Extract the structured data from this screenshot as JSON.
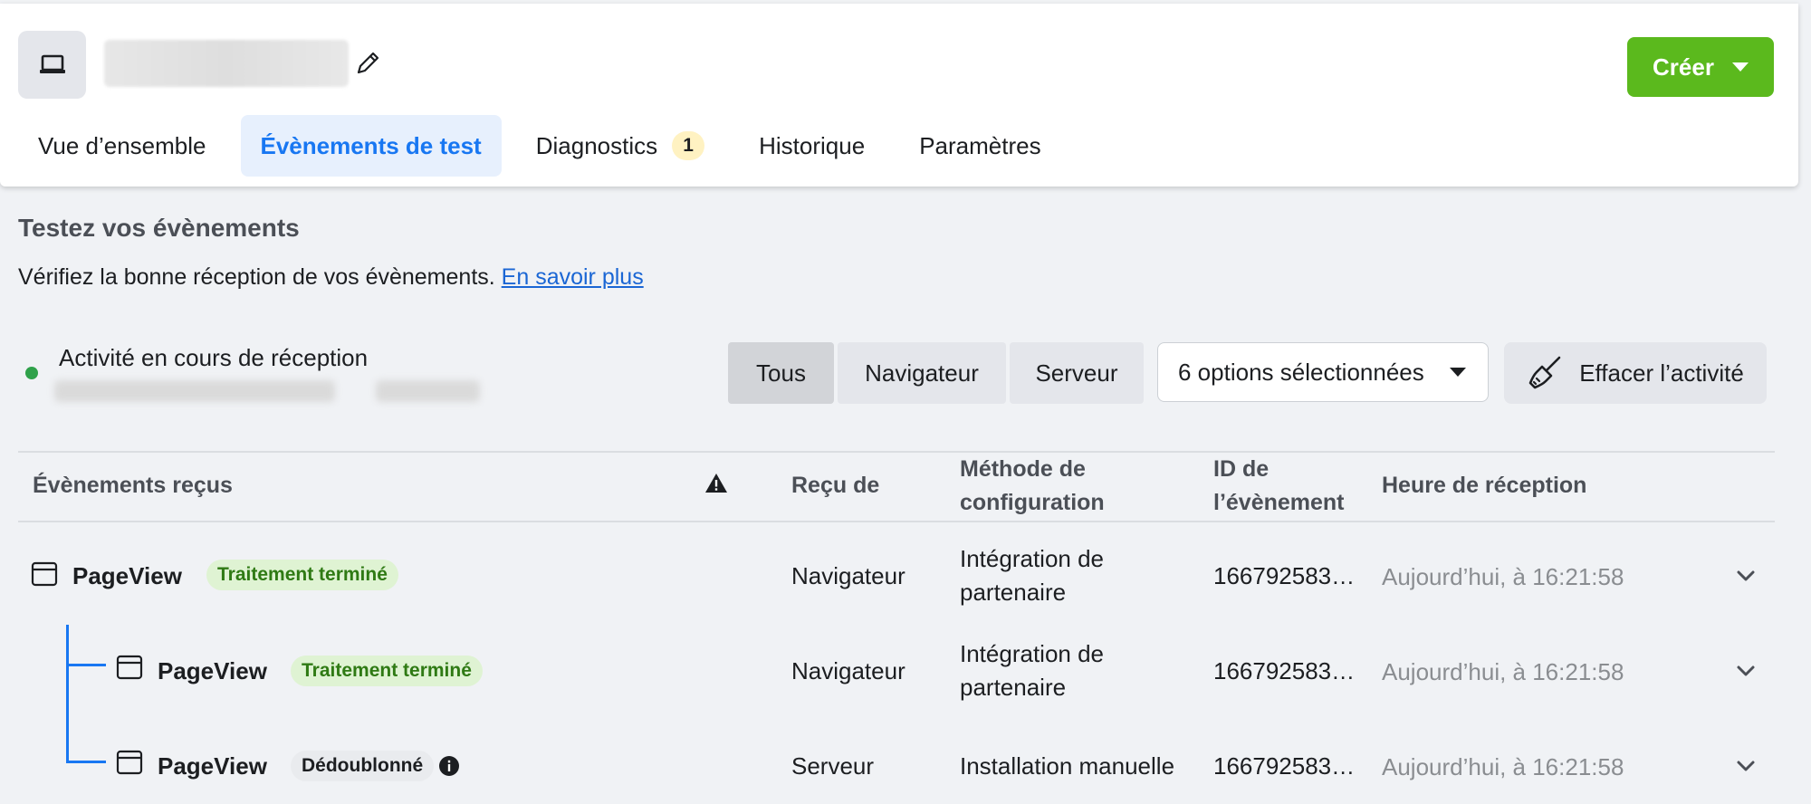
{
  "header": {
    "create_label": "Créer",
    "tabs": [
      {
        "label": "Vue d’ensemble"
      },
      {
        "label": "Évènements de test",
        "active": true
      },
      {
        "label": "Diagnostics",
        "badge": "1"
      },
      {
        "label": "Historique"
      },
      {
        "label": "Paramètres"
      }
    ]
  },
  "section": {
    "title": "Testez vos évènements",
    "description": "Vérifiez la bonne réception de vos évènements.",
    "link": "En savoir plus"
  },
  "activity": {
    "label": "Activité en cours de réception",
    "status_color": "#2fa14a"
  },
  "filters": {
    "segments": [
      "Tous",
      "Navigateur",
      "Serveur"
    ],
    "active_segment": "Tous",
    "dropdown_value": "6 options sélectionnées",
    "clear_label": "Effacer l’activité"
  },
  "table": {
    "headers": {
      "event": "Évènements reçus",
      "received_from": "Reçu de",
      "method_line1": "Méthode de",
      "method_line2": "configuration",
      "id_line1": "ID de",
      "id_line2": "l’évènement",
      "time": "Heure de réception"
    },
    "rows": [
      {
        "name": "PageView",
        "status": "Traitement terminé",
        "source": "Navigateur",
        "method_line1": "Intégration de",
        "method_line2": "partenaire",
        "id": "166792583…",
        "time": "Aujourd’hui, à 16:21:58"
      },
      {
        "name": "PageView",
        "status": "Traitement terminé",
        "source": "Navigateur",
        "method_line1": "Intégration de",
        "method_line2": "partenaire",
        "id": "166792583…",
        "time": "Aujourd’hui, à 16:21:58"
      },
      {
        "name": "PageView",
        "status": "Dédoublonné",
        "source": "Serveur",
        "method_line1": "Installation manuelle",
        "method_line2": "",
        "id": "166792583…",
        "time": "Aujourd’hui, à 16:21:58"
      }
    ]
  },
  "colors": {
    "accent": "#1877f2",
    "create_button": "#5bb91d",
    "status_green_bg": "#dff3d3",
    "status_green_text": "#2f7a14"
  }
}
